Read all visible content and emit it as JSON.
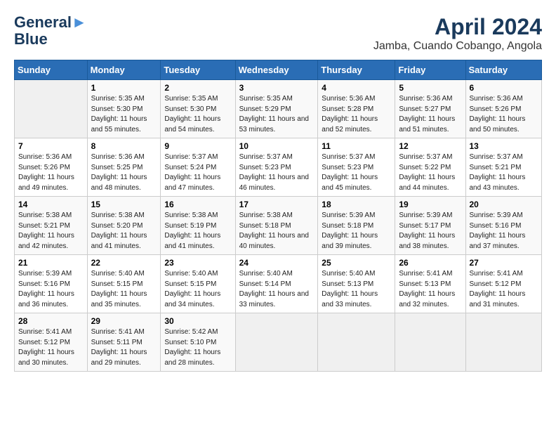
{
  "logo": {
    "line1": "General",
    "line2": "Blue"
  },
  "title": "April 2024",
  "subtitle": "Jamba, Cuando Cobango, Angola",
  "days_of_week": [
    "Sunday",
    "Monday",
    "Tuesday",
    "Wednesday",
    "Thursday",
    "Friday",
    "Saturday"
  ],
  "weeks": [
    [
      {
        "day": "",
        "empty": true
      },
      {
        "day": "1",
        "sunrise": "5:35 AM",
        "sunset": "5:30 PM",
        "daylight": "11 hours and 55 minutes."
      },
      {
        "day": "2",
        "sunrise": "5:35 AM",
        "sunset": "5:30 PM",
        "daylight": "11 hours and 54 minutes."
      },
      {
        "day": "3",
        "sunrise": "5:35 AM",
        "sunset": "5:29 PM",
        "daylight": "11 hours and 53 minutes."
      },
      {
        "day": "4",
        "sunrise": "5:36 AM",
        "sunset": "5:28 PM",
        "daylight": "11 hours and 52 minutes."
      },
      {
        "day": "5",
        "sunrise": "5:36 AM",
        "sunset": "5:27 PM",
        "daylight": "11 hours and 51 minutes."
      },
      {
        "day": "6",
        "sunrise": "5:36 AM",
        "sunset": "5:26 PM",
        "daylight": "11 hours and 50 minutes."
      }
    ],
    [
      {
        "day": "7",
        "sunrise": "5:36 AM",
        "sunset": "5:26 PM",
        "daylight": "11 hours and 49 minutes."
      },
      {
        "day": "8",
        "sunrise": "5:36 AM",
        "sunset": "5:25 PM",
        "daylight": "11 hours and 48 minutes."
      },
      {
        "day": "9",
        "sunrise": "5:37 AM",
        "sunset": "5:24 PM",
        "daylight": "11 hours and 47 minutes."
      },
      {
        "day": "10",
        "sunrise": "5:37 AM",
        "sunset": "5:23 PM",
        "daylight": "11 hours and 46 minutes."
      },
      {
        "day": "11",
        "sunrise": "5:37 AM",
        "sunset": "5:23 PM",
        "daylight": "11 hours and 45 minutes."
      },
      {
        "day": "12",
        "sunrise": "5:37 AM",
        "sunset": "5:22 PM",
        "daylight": "11 hours and 44 minutes."
      },
      {
        "day": "13",
        "sunrise": "5:37 AM",
        "sunset": "5:21 PM",
        "daylight": "11 hours and 43 minutes."
      }
    ],
    [
      {
        "day": "14",
        "sunrise": "5:38 AM",
        "sunset": "5:21 PM",
        "daylight": "11 hours and 42 minutes."
      },
      {
        "day": "15",
        "sunrise": "5:38 AM",
        "sunset": "5:20 PM",
        "daylight": "11 hours and 41 minutes."
      },
      {
        "day": "16",
        "sunrise": "5:38 AM",
        "sunset": "5:19 PM",
        "daylight": "11 hours and 41 minutes."
      },
      {
        "day": "17",
        "sunrise": "5:38 AM",
        "sunset": "5:18 PM",
        "daylight": "11 hours and 40 minutes."
      },
      {
        "day": "18",
        "sunrise": "5:39 AM",
        "sunset": "5:18 PM",
        "daylight": "11 hours and 39 minutes."
      },
      {
        "day": "19",
        "sunrise": "5:39 AM",
        "sunset": "5:17 PM",
        "daylight": "11 hours and 38 minutes."
      },
      {
        "day": "20",
        "sunrise": "5:39 AM",
        "sunset": "5:16 PM",
        "daylight": "11 hours and 37 minutes."
      }
    ],
    [
      {
        "day": "21",
        "sunrise": "5:39 AM",
        "sunset": "5:16 PM",
        "daylight": "11 hours and 36 minutes."
      },
      {
        "day": "22",
        "sunrise": "5:40 AM",
        "sunset": "5:15 PM",
        "daylight": "11 hours and 35 minutes."
      },
      {
        "day": "23",
        "sunrise": "5:40 AM",
        "sunset": "5:15 PM",
        "daylight": "11 hours and 34 minutes."
      },
      {
        "day": "24",
        "sunrise": "5:40 AM",
        "sunset": "5:14 PM",
        "daylight": "11 hours and 33 minutes."
      },
      {
        "day": "25",
        "sunrise": "5:40 AM",
        "sunset": "5:13 PM",
        "daylight": "11 hours and 33 minutes."
      },
      {
        "day": "26",
        "sunrise": "5:41 AM",
        "sunset": "5:13 PM",
        "daylight": "11 hours and 32 minutes."
      },
      {
        "day": "27",
        "sunrise": "5:41 AM",
        "sunset": "5:12 PM",
        "daylight": "11 hours and 31 minutes."
      }
    ],
    [
      {
        "day": "28",
        "sunrise": "5:41 AM",
        "sunset": "5:12 PM",
        "daylight": "11 hours and 30 minutes."
      },
      {
        "day": "29",
        "sunrise": "5:41 AM",
        "sunset": "5:11 PM",
        "daylight": "11 hours and 29 minutes."
      },
      {
        "day": "30",
        "sunrise": "5:42 AM",
        "sunset": "5:10 PM",
        "daylight": "11 hours and 28 minutes."
      },
      {
        "day": "",
        "empty": true
      },
      {
        "day": "",
        "empty": true
      },
      {
        "day": "",
        "empty": true
      },
      {
        "day": "",
        "empty": true
      }
    ]
  ],
  "labels": {
    "sunrise": "Sunrise:",
    "sunset": "Sunset:",
    "daylight": "Daylight:"
  }
}
